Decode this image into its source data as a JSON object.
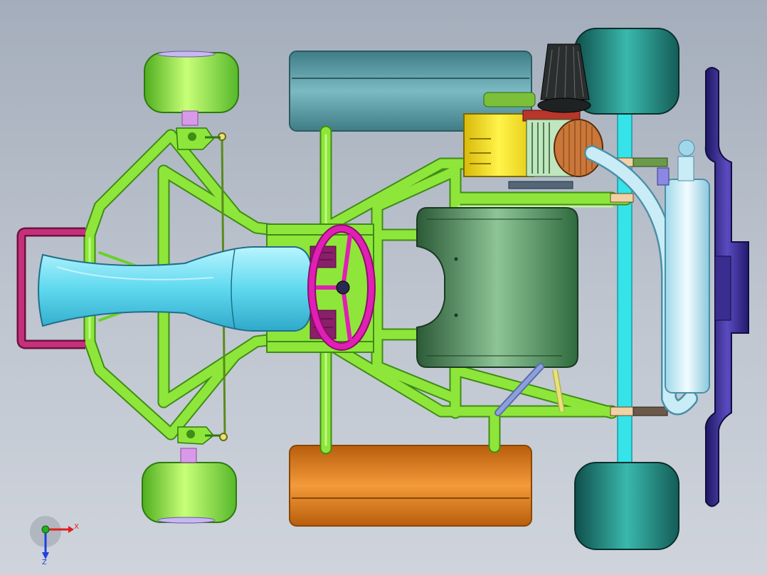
{
  "viewport": {
    "background_top": "#a4adbb",
    "background_bottom": "#cfd4dc"
  },
  "triad": {
    "x_label": "X",
    "z_label": "Z",
    "x_color": "#e02020",
    "y_color": "#20b020",
    "z_color": "#2040e0"
  },
  "colors": {
    "frame": "#8ee63a",
    "front_tire": "#8ee63a",
    "rear_tire": "#1f7a74",
    "seat": "#5fd9ef",
    "steering_wheel": "#e01fb4",
    "bumper_rear": "#3b2d8f",
    "bumper_front": "#b0226a",
    "side_pod_top": "#5b9ea8",
    "side_pod_bottom": "#e07e1a",
    "tank": "#3f7a4e",
    "engine": "#f2e418",
    "exhaust": "#c9ecf7",
    "axle": "#32e6e6"
  }
}
